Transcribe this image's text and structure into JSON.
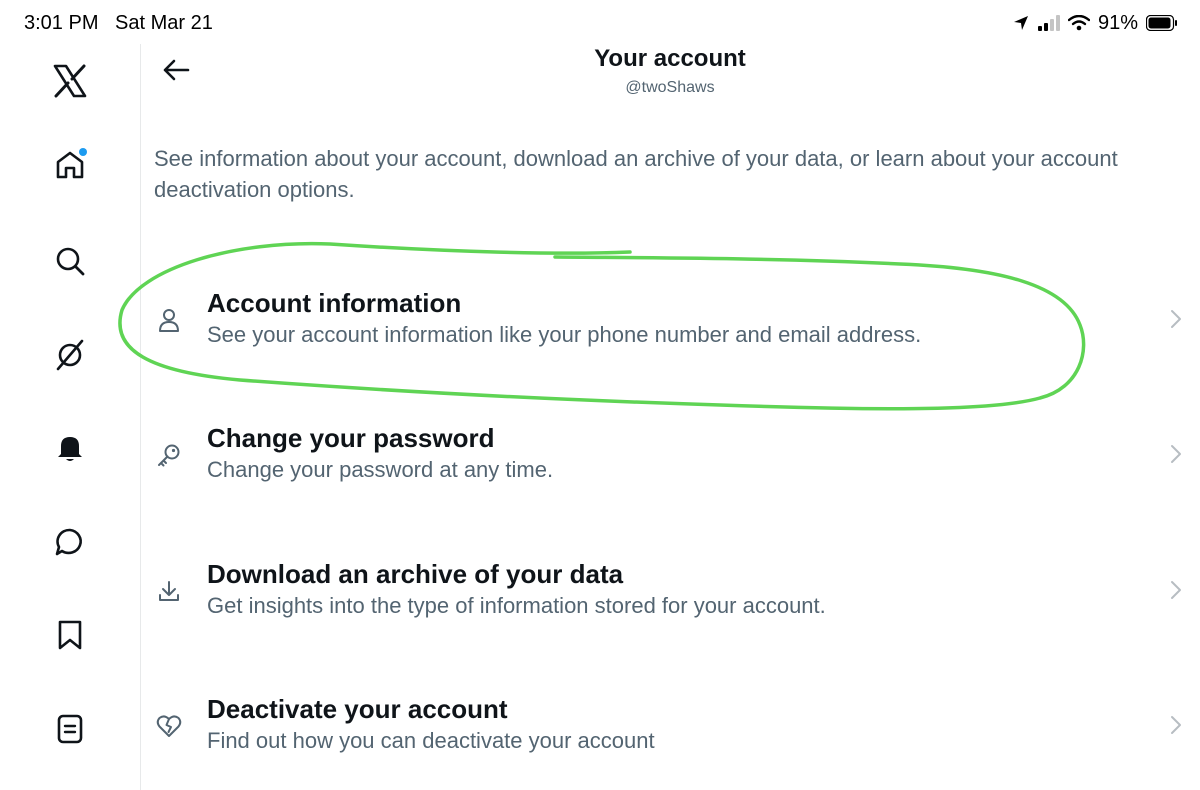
{
  "status_bar": {
    "time": "3:01 PM",
    "date": "Sat Mar 21",
    "battery_percent": "91%",
    "icons": [
      "location-arrow-icon",
      "cellular-signal-icon",
      "wifi-icon",
      "battery-icon"
    ]
  },
  "sidebar": {
    "items": [
      {
        "name": "x-logo",
        "icon": "x-logo-icon"
      },
      {
        "name": "home",
        "icon": "home-icon",
        "has_notification_dot": true
      },
      {
        "name": "explore",
        "icon": "search-icon"
      },
      {
        "name": "grok",
        "icon": "grok-icon"
      },
      {
        "name": "notifications",
        "icon": "bell-icon"
      },
      {
        "name": "messages",
        "icon": "message-icon"
      },
      {
        "name": "bookmarks",
        "icon": "bookmark-icon"
      },
      {
        "name": "lists",
        "icon": "list-icon"
      }
    ]
  },
  "header": {
    "back_icon": "arrow-left-icon",
    "title": "Your account",
    "subtitle": "@twoShaws"
  },
  "description": "See information about your account, download an archive of your data, or learn about your account deactivation options.",
  "menu": {
    "items": [
      {
        "icon": "person-icon",
        "title": "Account information",
        "description": "See your account information like your phone number and email address."
      },
      {
        "icon": "key-icon",
        "title": "Change your password",
        "description": "Change your password at any time."
      },
      {
        "icon": "download-icon",
        "title": "Download an archive of your data",
        "description": "Get insights into the type of information stored for your account."
      },
      {
        "icon": "broken-heart-icon",
        "title": "Deactivate your account",
        "description": "Find out how you can deactivate your account"
      }
    ],
    "chevron_icon": "chevron-right-icon"
  },
  "colors": {
    "primary_text": "#0f1419",
    "secondary_text": "#536471",
    "notification_dot": "#1d9bf0",
    "annotation_circle": "#5fd454",
    "chevron": "#b7bdc2"
  }
}
